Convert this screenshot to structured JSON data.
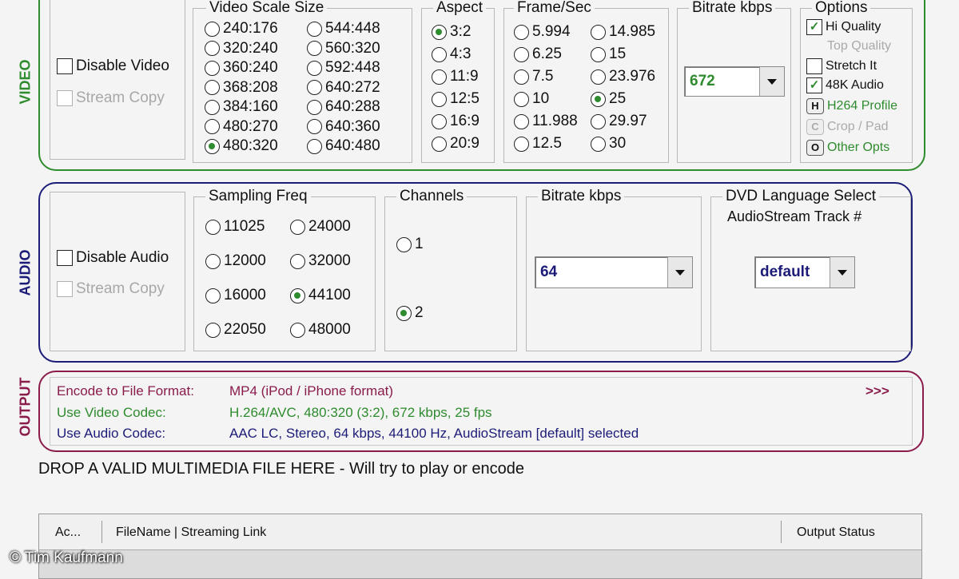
{
  "video": {
    "section_label": "VIDEO",
    "disable_label": "Disable Video",
    "stream_copy_label": "Stream Copy",
    "scale": {
      "legend": "Video Scale Size",
      "col1": [
        "240:176",
        "320:240",
        "360:240",
        "368:208",
        "384:160",
        "480:270",
        "480:320"
      ],
      "col2": [
        "544:448",
        "560:320",
        "592:448",
        "640:272",
        "640:288",
        "640:360",
        "640:480"
      ],
      "selected": "480:320"
    },
    "aspect": {
      "legend": "Aspect",
      "options": [
        "3:2",
        "4:3",
        "11:9",
        "12:5",
        "16:9",
        "20:9"
      ],
      "selected": "3:2"
    },
    "fps": {
      "legend": "Frame/Sec",
      "col1": [
        "5.994",
        "6.25",
        "7.5",
        "10",
        "11.988",
        "12.5"
      ],
      "col2": [
        "14.985",
        "15",
        "23.976",
        "25",
        "29.97",
        "30"
      ],
      "selected": "25"
    },
    "bitrate": {
      "legend": "Bitrate  kbps",
      "value": "672"
    },
    "options": {
      "legend": "Options",
      "hi_quality": "Hi Quality",
      "top_quality": "Top Quality",
      "stretch": "Stretch It",
      "audio48k": "48K Audio",
      "h264_key": "H",
      "h264": "H264 Profile",
      "crop_key": "C",
      "crop": "Crop / Pad",
      "other_key": "O",
      "other": "Other Opts"
    }
  },
  "audio": {
    "section_label": "AUDIO",
    "disable_label": "Disable Audio",
    "stream_copy_label": "Stream Copy",
    "freq": {
      "legend": "Sampling Freq",
      "col1": [
        "11025",
        "12000",
        "16000",
        "22050"
      ],
      "col2": [
        "24000",
        "32000",
        "44100",
        "48000"
      ],
      "selected": "44100"
    },
    "channels": {
      "legend": "Channels",
      "options": [
        "1",
        "2"
      ],
      "selected": "2"
    },
    "bitrate": {
      "legend": "Bitrate  kbps",
      "value": "64"
    },
    "dvd": {
      "legend": "DVD Language Select",
      "sub": "AudioStream  Track #",
      "value": "default"
    }
  },
  "output": {
    "section_label": "OUTPUT",
    "format_label": "Encode to File Format:",
    "format_value": "MP4 (iPod / iPhone format)",
    "more": ">>>",
    "vcodec_label": "Use Video Codec:",
    "vcodec_value": "H.264/AVC,  480:320 (3:2),  672 kbps,  25 fps",
    "acodec_label": "Use Audio Codec:",
    "acodec_value": "AAC LC,  Stereo,  64 kbps,  44100 Hz,  AudioStream [default] selected"
  },
  "drop_text": "DROP A VALID MULTIMEDIA FILE HERE - Will try to play or encode",
  "table": {
    "col_action": "Ac...",
    "col_file": "FileName  |  Streaming Link",
    "col_status": "Output Status"
  },
  "watermark": "© Tim Kaufmann",
  "colors": {
    "video": "#2e8b2e",
    "audio": "#1c1c78",
    "output": "#8a1c4c"
  }
}
